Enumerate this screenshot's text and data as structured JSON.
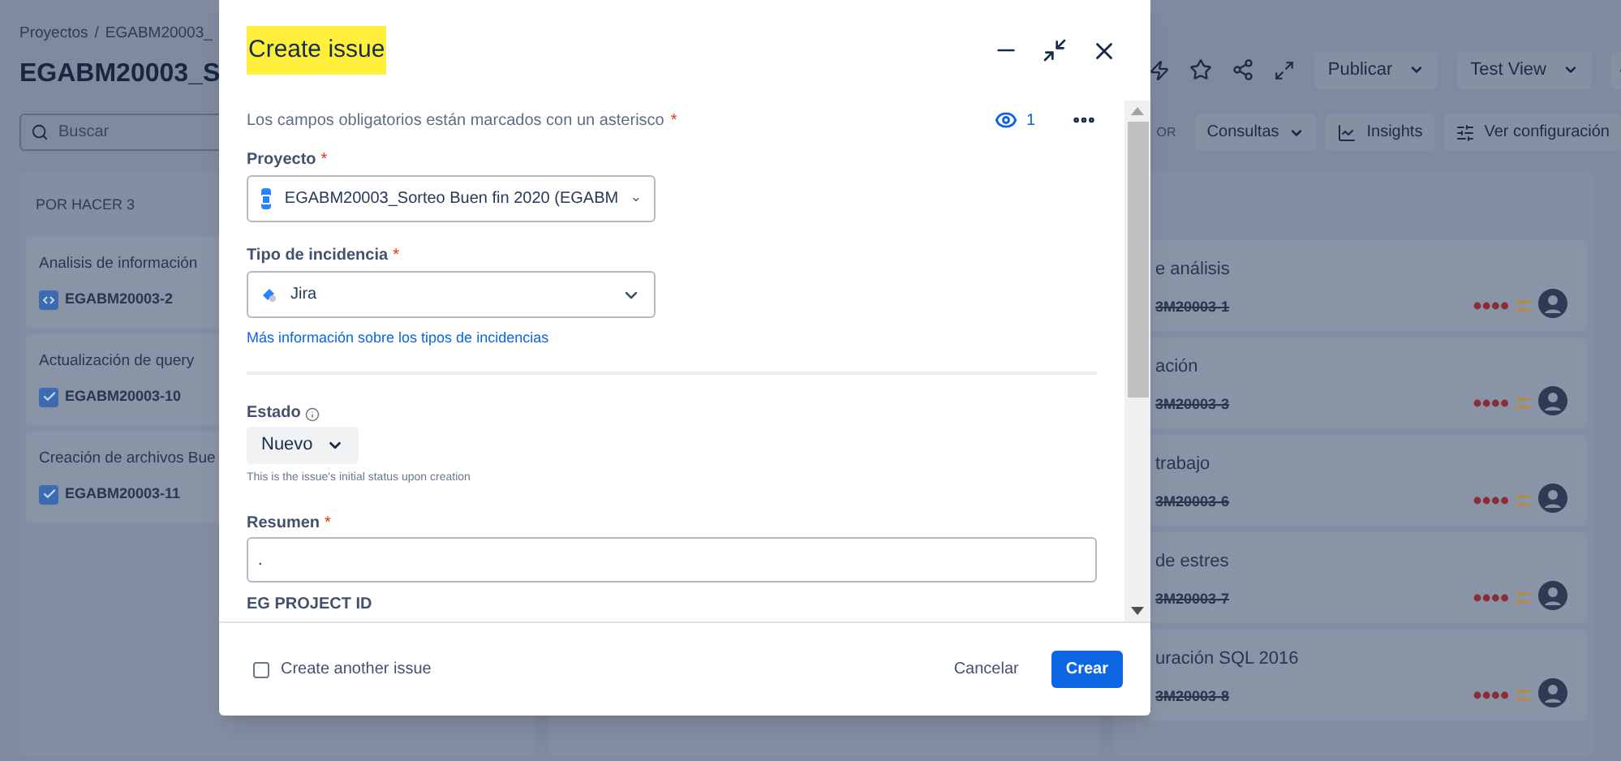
{
  "breadcrumbs": [
    "Proyectos",
    "/",
    "EGABM20003_"
  ],
  "page_title": "EGABM20003_S",
  "toolbar": {
    "buttons": [
      "Publicar",
      "Test View"
    ]
  },
  "filters": {
    "search": {
      "placeholder": "Buscar"
    },
    "group_label": "OR",
    "buttons": [
      {
        "kind": "dropdown",
        "label": "Consultas"
      },
      {
        "kind": "insights",
        "label": "Insights"
      },
      {
        "kind": "settings",
        "label": "Ver configuración"
      }
    ]
  },
  "columns": [
    {
      "title": "POR HACER 3",
      "cards": [
        {
          "title": "Analisis de información",
          "key": "EGABM20003-2",
          "kind": "code",
          "done": false
        },
        {
          "title": "Actualización de query",
          "key": "EGABM20003-10",
          "kind": "task",
          "done": false
        },
        {
          "title": "Creación de archivos Bue",
          "key": "EGABM20003-11",
          "kind": "task",
          "done": false
        }
      ]
    },
    {
      "cards": [
        {
          "title": "e análisis",
          "key": "3M20003-1",
          "done": true
        },
        {
          "title": "ación",
          "key": "3M20003-3",
          "done": true
        },
        {
          "title": "trabajo",
          "key": "3M20003-6",
          "done": true
        },
        {
          "title": "de estres",
          "key": "3M20003-7",
          "done": true
        },
        {
          "title": "uración SQL 2016",
          "key": "3M20003-8",
          "done": true
        }
      ]
    }
  ],
  "modal": {
    "title": "Create issue",
    "highlighted": true,
    "required_note": "Los campos obligatorios están marcados con un asterisco",
    "required_mark": "*",
    "watchers": "1",
    "fields": [
      {
        "kind": "select",
        "label": "Proyecto",
        "required": true,
        "value": "EGABM20003_Sorteo Buen fin 2020 (EGABM"
      },
      {
        "kind": "select",
        "label": "Tipo de incidencia",
        "required": true,
        "value": "Jira",
        "link": "Más información sobre los tipos de incidencias"
      },
      {
        "kind": "divider"
      },
      {
        "kind": "status",
        "label": "Estado",
        "required": false,
        "value": "Nuevo",
        "help": "This is the issue's initial status upon creation"
      },
      {
        "kind": "text",
        "label": "Resumen",
        "required": true,
        "value": "."
      },
      {
        "kind": "heading",
        "label": "EG PROJECT ID",
        "required": false
      }
    ],
    "create_another": {
      "label": "Create another issue",
      "checked": false
    },
    "buttons": [
      {
        "kind": "subtle",
        "label": "Cancelar"
      },
      {
        "kind": "primary",
        "label": "Crear"
      }
    ]
  }
}
